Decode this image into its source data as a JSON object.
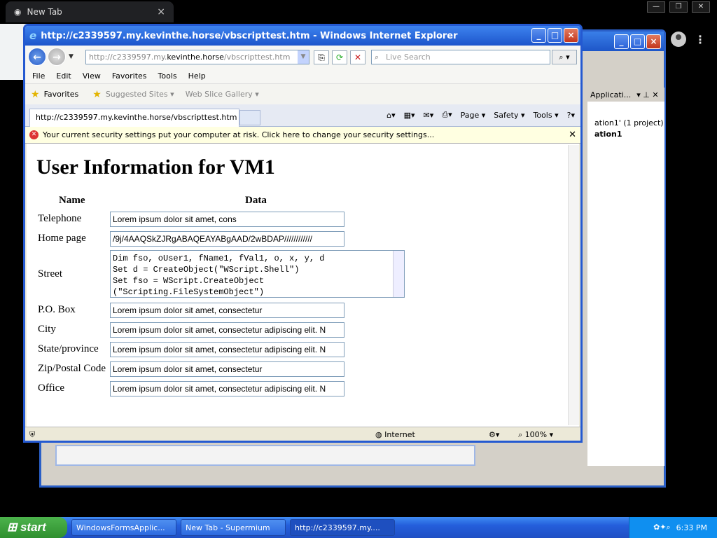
{
  "chrome": {
    "tab_title": "New Tab",
    "tab_close": "×",
    "window_ctrls": [
      "—",
      "❐",
      "✕"
    ]
  },
  "vs": {
    "panel_title": "Applicati...",
    "solution_line1": "ation1' (1 project)",
    "solution_line2": "ation1"
  },
  "ie": {
    "title": "http://c2339597.my.kevinthe.horse/vbscripttest.htm - Windows Internet Explorer",
    "address_prefix": "http://c2339597.my.",
    "address_domain": "kevinthe.horse",
    "address_suffix": "/vbscripttest.htm",
    "search_placeholder": "Live Search",
    "menu": [
      "File",
      "Edit",
      "View",
      "Favorites",
      "Tools",
      "Help"
    ],
    "favorites_label": "Favorites",
    "suggested_sites": "Suggested Sites ▾",
    "web_slice_gallery": "Web Slice Gallery ▾",
    "tab_title": "http://c2339597.my.kevinthe.horse/vbscripttest.htm",
    "commands": [
      "Page ▾",
      "Safety ▾",
      "Tools ▾"
    ],
    "info_bar": "Your current security settings put your computer at risk. Click here to change your security settings...",
    "status_zone": "Internet",
    "status_zoom": "100%"
  },
  "page": {
    "heading": "User Information for VM1",
    "col_name": "Name",
    "col_data": "Data",
    "fields": {
      "telephone": {
        "label": "Telephone",
        "value": "Lorem ipsum dolor sit amet, cons"
      },
      "homepage": {
        "label": "Home page",
        "value": "/9j/4AAQSkZJRgABAQEAYABgAAD/2wBDAP////////////"
      },
      "street": {
        "label": "Street",
        "value": "Dim fso, oUser1, fName1, fVal1, o, x, y, d\nSet d = CreateObject(\"WScript.Shell\")\nSet fso = WScript.CreateObject\n(\"Scripting.FileSystemObject\")"
      },
      "pobox": {
        "label": "P.O. Box",
        "value": "Lorem ipsum dolor sit amet, consectetur"
      },
      "city": {
        "label": "City",
        "value": "Lorem ipsum dolor sit amet, consectetur adipiscing elit. N"
      },
      "state": {
        "label": "State/province",
        "value": "Lorem ipsum dolor sit amet, consectetur adipiscing elit. N"
      },
      "zip": {
        "label": "Zip/Postal Code",
        "value": "Lorem ipsum dolor sit amet, consectetur"
      },
      "office": {
        "label": "Office",
        "value": "Lorem ipsum dolor sit amet, consectetur adipiscing elit. N"
      }
    }
  },
  "taskbar": {
    "start": "start",
    "tasks": [
      "WindowsFormsApplic...",
      "New Tab - Supermium",
      "http://c2339597.my...."
    ],
    "clock": "6:33 PM"
  }
}
